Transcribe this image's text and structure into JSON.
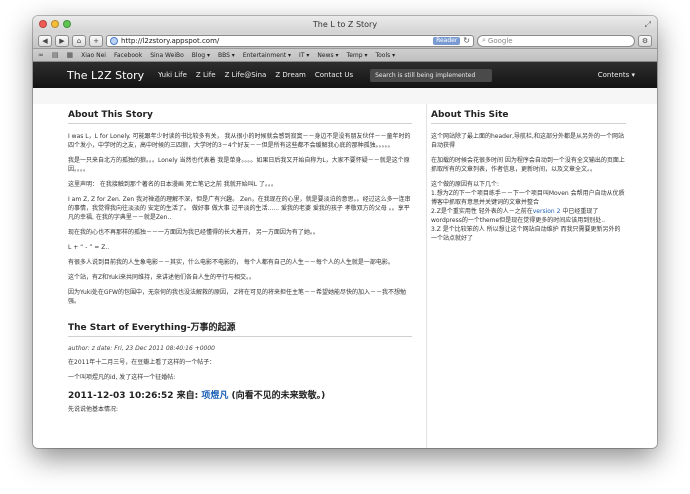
{
  "window": {
    "title": "The L to Z Story"
  },
  "toolbar": {
    "back": "◀",
    "forward": "▶",
    "home": "⌂",
    "add": "+",
    "url": "http://l2zstory.appspot.com/",
    "reader": "Reader",
    "search_placeholder": "Google"
  },
  "bookmarks": [
    "Xiao Nei",
    "Facebook",
    "Sina WeiBo",
    "Blog ▾",
    "BBS ▾",
    "Entertainment ▾",
    "IT ▾",
    "News ▾",
    "Temp ▾",
    "Tools ▾"
  ],
  "site": {
    "brand": "The L2Z Story",
    "nav": [
      "Yuki Life",
      "Z Life",
      "Z Life@Sina",
      "Z Dream",
      "Contact Us"
    ],
    "search_text": "Search is still being implemented",
    "contents": "Contents ▾"
  },
  "main": {
    "about_title": "About This Story",
    "paragraphs": [
      "I was L，L for Lonely. 可能跟年少时读的书比较多有关， 我从很小的时候就会感到寂寞－－身边不是没有朋友伙伴－－童年时的四个发小，中学时的之友，高中时候的三四狼，大学时的3－4个好友－－但是所有这些都不会缓解我心底的那种孤独。。。。。",
      "我是一只来自北方的孤独的狼。。。Lonely 当然也代表着 我是单身。。。。如果日后我又开始自称为L，大家不要怀疑－－就是这个原因。。。。",
      "这里声明： 在我接触到那个著名的日本漫画 死亡笔记之前 我就开始叫L 了。。。",
      "I am Z, Z for Zen. Zen 我对禅道的理解不深，但是广有兴趣。 Zen，在我现在的心里，就是要淡泊的意思。。经过这么多一连串的事情，我觉得我向往淡淡的 安定的生活了。 做好事 做大事 过平淡的生活...... 爱我的老婆 爱我的孩子 孝敬双方的父母 。。享平凡的幸福, 在我的字典里－－就是Zen..",
      "现在我的心也不再那样的孤独－－一方面因为我已经懂得的长大着开， 另一方面因为有了她。。",
      "L + “ - ” = Z..",
      "有很多人说到目前我的人生象电影－－其实，什么电影不电影的， 每个人都有自己的人生－－每个人的人生就是一部电影。",
      "这个站，有Z和Yuki来共同维持，来讲述他们各自人生的平行与相交。。",
      "因为Yuki处在GFW的包围中，无奈何的我也没法解救的原因， Z将在可见的将来担任主笔－－希望她能尽快的加入－－我不想勉强。"
    ],
    "section2_title": "The Start of Everything-万事的起源",
    "meta": "author: z    date: Fri, 23 Dec 2011 08:40:16 +0000",
    "post_lines": [
      "在2011年十二月三号，在豆瓣上看了这样的一个帖子：",
      "一个叫项煜凡的id, 发了这样一个征婚帖:"
    ],
    "post_title_prefix": "2011-12-03 10:26:52 来自: ",
    "post_title_author": "项煜凡",
    "post_title_suffix": " (向看不见的未来致敬。)",
    "post_intro": "先说说他基本情况:"
  },
  "side": {
    "title": "About This Site",
    "p1": "这个网站除了最上面的header,导航栏,和这部分外都是从另外的一个网站自动获得",
    "p2": "在加载的时候会花很多时间 因为程序会自动到一个没有全文输出的页面上抓取所有的文章列表，作者信息，更新时间，以及文章全文。。",
    "p3": "这个做的原因有以下几个:",
    "p4": "1.想为Z的下一个项目练手－－下一个项目叫Moven 会帮用户自动从优质博客中抓取有意思并关键词的文章并整合",
    "p5_before": "2.Z是个重实用性 轻外表的人－之前在",
    "p5_link": "version 2",
    "p5_after": " 中已经重现了wordpress的一个theme但是现在觉得更多的时间应该用到别处..",
    "p6": "3.Z 是个比较笨的人 所以想让这个网站自动维护 而我只需要更新另外的一个站点就好了"
  }
}
